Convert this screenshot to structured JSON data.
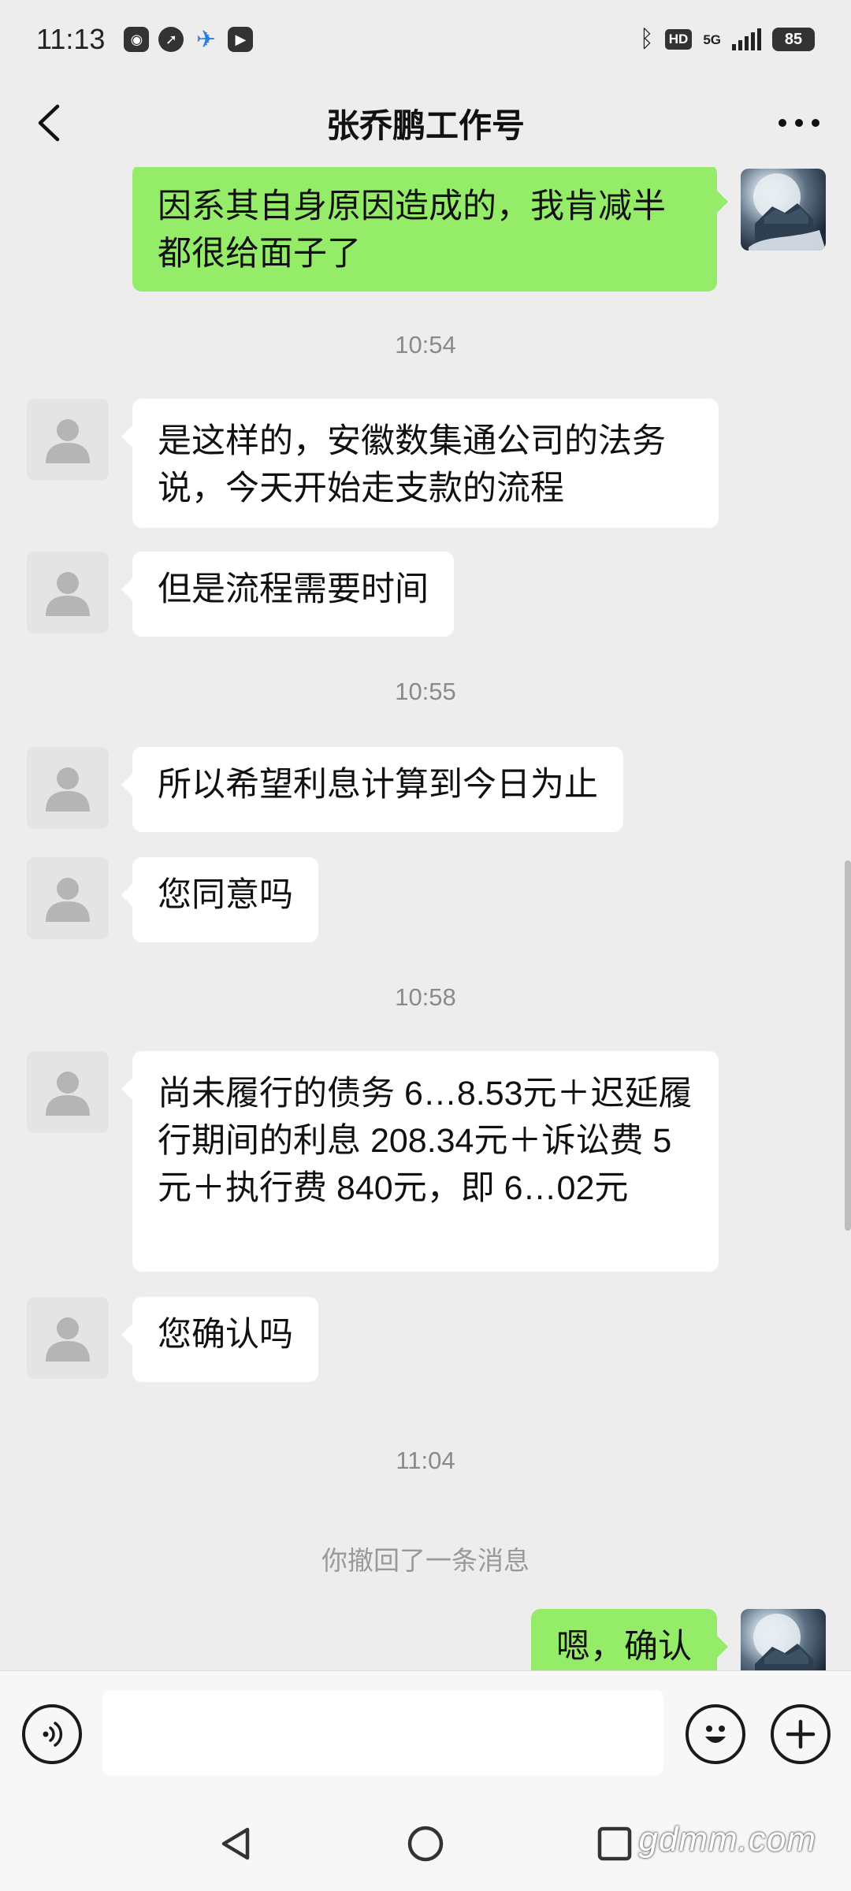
{
  "status_bar": {
    "time": "11:13",
    "network": "5G",
    "hd_badge": "HD",
    "battery": "85"
  },
  "header": {
    "title": "张乔鹏工作号"
  },
  "messages": [
    {
      "side": "out",
      "text": "因系其自身原因造成的，我肯减半都很给面子了"
    },
    {
      "time": "10:54"
    },
    {
      "side": "in",
      "text": "是这样的，安徽数集通公司的法务说，今天开始走支款的流程"
    },
    {
      "side": "in",
      "text": "但是流程需要时间"
    },
    {
      "time": "10:55"
    },
    {
      "side": "in",
      "text": "所以希望利息计算到今日为止"
    },
    {
      "side": "in",
      "text": "您同意吗"
    },
    {
      "time": "10:58"
    },
    {
      "side": "in",
      "text": "尚未履行的债务 6…8.53元＋迟延履行期间的利息 208.34元＋诉讼费 5元＋执行费 840元，即 6…02元"
    },
    {
      "side": "in",
      "text": "您确认吗"
    },
    {
      "time": "11:04"
    },
    {
      "system": "你撤回了一条消息"
    },
    {
      "side": "out",
      "text": "嗯，确认"
    }
  ],
  "input": {
    "placeholder": ""
  },
  "watermark": "gdmm.com",
  "colors": {
    "background": "#ededed",
    "outgoing_bubble": "#95ec69",
    "incoming_bubble": "#ffffff"
  }
}
